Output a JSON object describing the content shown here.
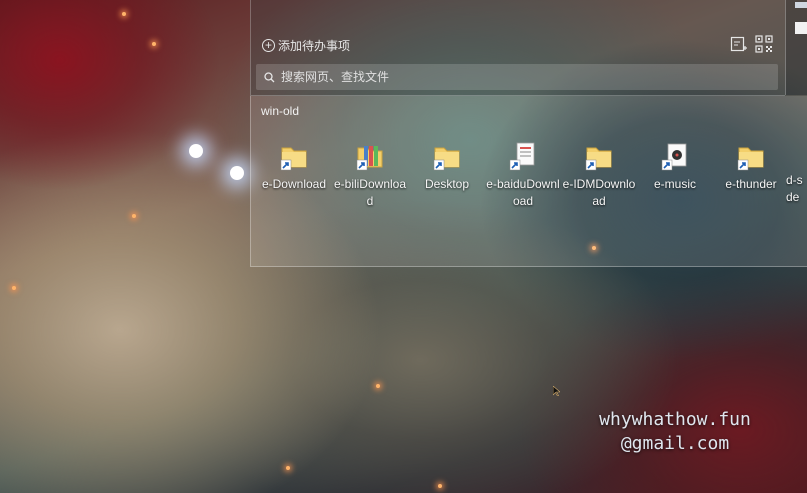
{
  "toolbar": {
    "todo_label": "添加待办事项",
    "search_placeholder": "搜索网页、查找文件"
  },
  "folder_panel": {
    "title": "win-old",
    "items": [
      {
        "label": "e-Download",
        "icon": "folder-shortcut-icon"
      },
      {
        "label": "e-biliDownload",
        "icon": "archive-folder-shortcut-icon"
      },
      {
        "label": "Desktop",
        "icon": "folder-shortcut-icon"
      },
      {
        "label": "e-baiduDownload",
        "icon": "document-folder-shortcut-icon"
      },
      {
        "label": "e-IDMDownload",
        "icon": "folder-shortcut-icon"
      },
      {
        "label": "e-music",
        "icon": "music-folder-shortcut-icon"
      },
      {
        "label": "e-thunder",
        "icon": "folder-shortcut-icon"
      },
      {
        "label": "d-s de",
        "icon": "folder-shortcut-icon"
      }
    ]
  },
  "watermark": {
    "line1": "whywhathow.fun",
    "line2": "@gmail.com"
  },
  "colors": {
    "folder": "#f3cf6a",
    "shortcut_arrow": "#1e5fb4"
  }
}
